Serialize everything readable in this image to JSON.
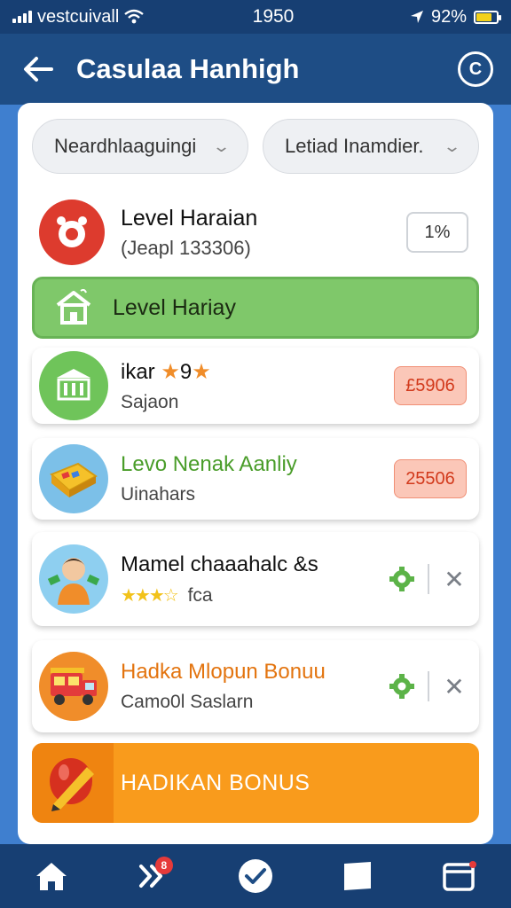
{
  "status_bar": {
    "carrier": "vestcuivall",
    "time": "1950",
    "battery": "92%",
    "battery_level": 0.7
  },
  "header": {
    "title": "Casulaa Hanhigh",
    "back_icon": "arrow-left-icon",
    "action_icon": "circle-c-icon",
    "action_label": "C"
  },
  "filters": [
    {
      "label": "Neardhlaaguingi",
      "icon": "chevron-down-icon"
    },
    {
      "label": "Letiad Inamdier.",
      "icon": "chevron-down-icon"
    }
  ],
  "level": {
    "title": "Level Haraian",
    "subtitle": "(Jeapl 133306)",
    "pill": "1%",
    "icon": "alarm-clock-icon"
  },
  "green_banner": {
    "label": "Level Hariay",
    "icon": "house-icon"
  },
  "cards": [
    {
      "title": "ikar",
      "title_suffix": "9",
      "subtitle": "Sajaon",
      "badge": "£5906",
      "icon": "bank-icon",
      "rating_stars": 2
    },
    {
      "title": "Levo Nenak Aanliy",
      "subtitle": "Uinahars",
      "badge": "25506",
      "icon": "gift-box-icon"
    },
    {
      "title": "Mamel chaaahalc &s",
      "subtitle": "fca",
      "rating": 3.5,
      "icon": "person-avatar-icon",
      "actions": [
        "gear-icon",
        "close-icon"
      ]
    },
    {
      "title": "Hadka Mlopun Bonuu",
      "subtitle": "Camo0l Saslarn",
      "icon": "truck-icon",
      "actions": [
        "gear-icon",
        "close-icon"
      ]
    }
  ],
  "orange_banner": {
    "label": "HADIKAN BONUS",
    "icon": "pencil-balloon-icon"
  },
  "bottom_nav": [
    {
      "icon": "home-icon"
    },
    {
      "icon": "double-chevron-icon",
      "badge": "8"
    },
    {
      "icon": "compass-check-icon"
    },
    {
      "icon": "chat-square-icon"
    },
    {
      "icon": "window-icon"
    }
  ],
  "colors": {
    "header": "#1e4d85",
    "status_bar": "#173f73",
    "background": "#3f7fcf",
    "green": "#7fc86a",
    "orange": "#f99b1c",
    "red": "#dd3b2e",
    "card2_title": "#4a9d2a",
    "card4_title": "#e3740f"
  }
}
